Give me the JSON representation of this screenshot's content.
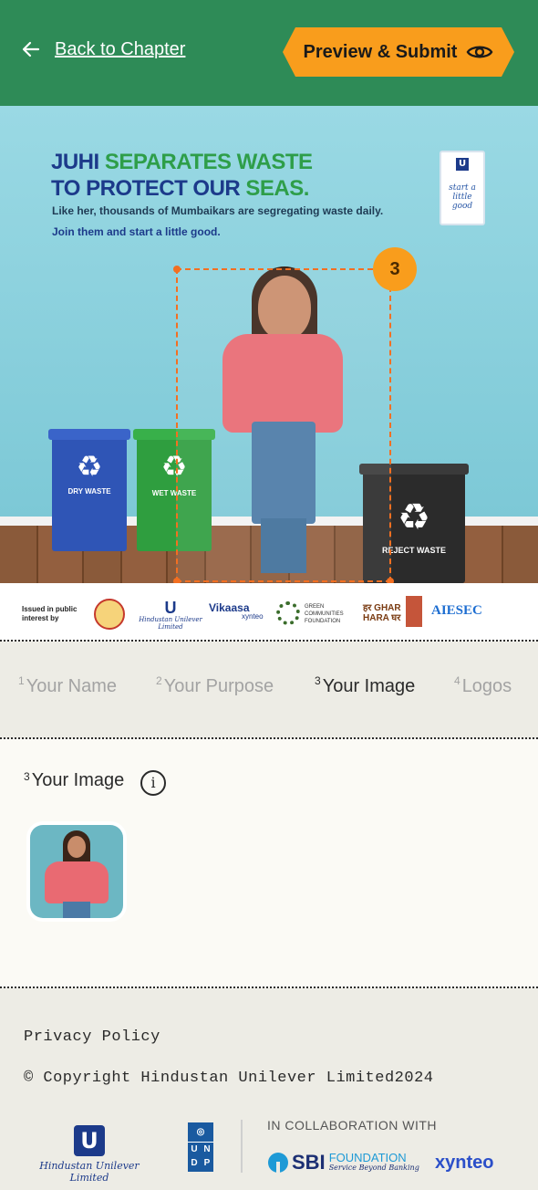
{
  "header": {
    "back_label": "Back to Chapter",
    "submit_label": "Preview & Submit"
  },
  "poster": {
    "headline_1a": "JUHI ",
    "headline_1b": "SEPARATES WASTE",
    "headline_2a": "TO PROTECT OUR ",
    "headline_2b": "SEAS.",
    "subline": "Like her, thousands of Mumbaikars are segregating waste daily.",
    "cta": "Join them and start a little good.",
    "badge_text": "start a little good",
    "bins": [
      {
        "label": "DRY WASTE",
        "color": "#2f55b6"
      },
      {
        "label": "WET WASTE",
        "color": "#2f9e3f"
      },
      {
        "label": "REJECT WASTE",
        "color": "#2b2b2b"
      }
    ],
    "selection_number": "3",
    "accent_color": "#f36f21"
  },
  "logos": {
    "issued": "Issued in public interest by",
    "items": [
      "Hindustan Unilever Limited",
      "Vikaasa",
      "xynteo",
      "GREEN COMMUNITIES FOUNDATION",
      "हर GHAR HARA घर",
      "AIESEC"
    ]
  },
  "steps": [
    {
      "num": "1",
      "label": "Your Name"
    },
    {
      "num": "2",
      "label": "Your Purpose"
    },
    {
      "num": "3",
      "label": "Your Image"
    },
    {
      "num": "4",
      "label": "Logos"
    }
  ],
  "section": {
    "num": "3",
    "title": "Your Image",
    "info_glyph": "i"
  },
  "footer": {
    "privacy": "Privacy Policy",
    "copyright": "© Copyright Hindustan Unilever Limited2024",
    "collab": "IN COLLABORATION WITH",
    "hul": "Hindustan Unilever Limited",
    "undp": [
      "U",
      "N",
      "D",
      "P"
    ],
    "sbi": "SBI",
    "sbi_foundation": "FOUNDATION",
    "sbi_tagline": "Service Beyond Banking",
    "xynteo": "xynteo"
  },
  "colors": {
    "header_green": "#2e8b57",
    "submit_orange": "#f99d1c"
  }
}
